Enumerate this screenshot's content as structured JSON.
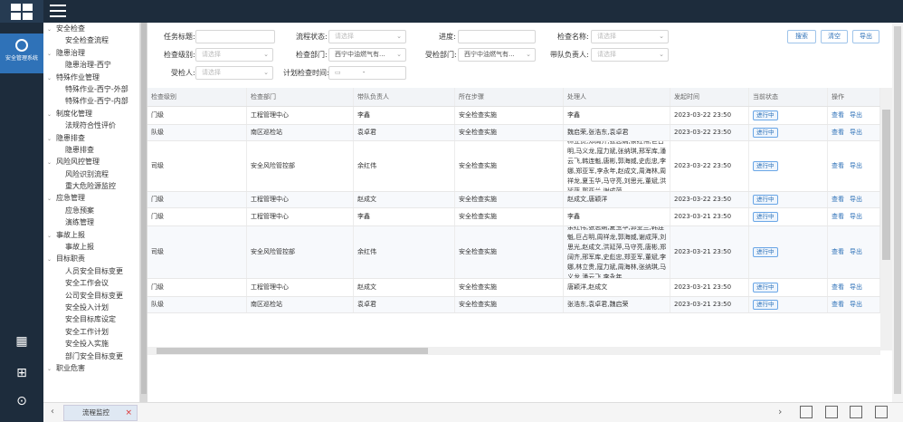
{
  "app": {
    "module_label": "安全管理系统"
  },
  "tree": [
    {
      "label": "安全检查",
      "type": "p"
    },
    {
      "label": "安全检查流程",
      "type": "c"
    },
    {
      "label": "隐患治理",
      "type": "p"
    },
    {
      "label": "隐患治理-西宁",
      "type": "c"
    },
    {
      "label": "特殊作业管理",
      "type": "p"
    },
    {
      "label": "特殊作业-西宁-外部",
      "type": "c"
    },
    {
      "label": "特殊作业-西宁-内部",
      "type": "c"
    },
    {
      "label": "制度化管理",
      "type": "p"
    },
    {
      "label": "法规符合性评价",
      "type": "c"
    },
    {
      "label": "隐患排查",
      "type": "p"
    },
    {
      "label": "隐患排查",
      "type": "c"
    },
    {
      "label": "风险风控管理",
      "type": "p"
    },
    {
      "label": "风险识别流程",
      "type": "c"
    },
    {
      "label": "重大危险源监控",
      "type": "c"
    },
    {
      "label": "应急管理",
      "type": "p"
    },
    {
      "label": "应急预案",
      "type": "c"
    },
    {
      "label": "演练管理",
      "type": "c"
    },
    {
      "label": "事故上报",
      "type": "p"
    },
    {
      "label": "事故上报",
      "type": "c"
    },
    {
      "label": "目标职责",
      "type": "p"
    },
    {
      "label": "人员安全目标变更",
      "type": "c"
    },
    {
      "label": "安全工作会议",
      "type": "c"
    },
    {
      "label": "公司安全目标变更",
      "type": "c"
    },
    {
      "label": "安全投入计划",
      "type": "c"
    },
    {
      "label": "安全目标库设定",
      "type": "c"
    },
    {
      "label": "安全工作计划",
      "type": "c"
    },
    {
      "label": "安全投入实施",
      "type": "c"
    },
    {
      "label": "部门安全目标变更",
      "type": "c"
    },
    {
      "label": "职业危害",
      "type": "p"
    }
  ],
  "filters": {
    "task_title": "任务标题:",
    "process_status": "流程状态:",
    "process_status_ph": "请选择",
    "progress": "进度:",
    "check_name": "检查名称:",
    "check_name_ph": "请选择",
    "check_level": "检查级别:",
    "check_level_ph": "请选择",
    "check_dept": "检查部门:",
    "check_dept_val": "西宁中油燃气有...",
    "checked_dept": "受检部门:",
    "checked_dept_val": "西宁中油燃气有...",
    "team_leader": "带队负责人:",
    "team_leader_ph": "请选择",
    "inspected": "受检人:",
    "inspected_ph": "请选择",
    "plan_time": "计划检查时间:",
    "plan_time_sep": "-"
  },
  "buttons": {
    "search": "搜索",
    "clear": "清空",
    "export": "导出"
  },
  "columns": [
    "检查级别",
    "检查部门",
    "带队负责人",
    "所在步骤",
    "处理人",
    "发起时间",
    "当前状态",
    "操作"
  ],
  "rows": [
    {
      "level": "门级",
      "dept": "工程管理中心",
      "leader": "李鑫",
      "step": "安全检查实施",
      "handler": "李鑫",
      "time": "2023-03-22 23:50",
      "status": "进行中"
    },
    {
      "level": "队级",
      "dept": "南区巡检站",
      "leader": "袁卓君",
      "step": "安全检查实施",
      "handler": "魏启荣,张浩东,袁卓君",
      "time": "2023-03-22 23:50",
      "status": "进行中"
    },
    {
      "level": "司级",
      "dept": "安全风险管控部",
      "leader": "余红伟",
      "step": "安全检查实施",
      "handler": "林立贵,郑阔齐,张志娴,余红伟,巨占明,马义龙,寇力斌,张纳琪,邢军库,潘云飞,韩连魁,唐彬,郭海威,史彪忠,李娜,郑亚军,李永年,赵成文,周海林,周祥龙,夏玉华,马守亮,刘思光,董斌,洪延萍,郭亚兰,谢成萍",
      "time": "2023-03-22 23:50",
      "status": "进行中"
    },
    {
      "level": "门级",
      "dept": "工程管理中心",
      "leader": "赵成文",
      "step": "安全检查实施",
      "handler": "赵成文,唐颖洋",
      "time": "2023-03-22 23:50",
      "status": "进行中"
    },
    {
      "level": "门级",
      "dept": "工程管理中心",
      "leader": "李鑫",
      "step": "安全检查实施",
      "handler": "李鑫",
      "time": "2023-03-21 23:50",
      "status": "进行中"
    },
    {
      "level": "司级",
      "dept": "安全风险管控部",
      "leader": "余红伟",
      "step": "安全检查实施",
      "handler": "余红伟,张志娴,夏玉华,郭亚兰,韩连魁,巨占明,周祥龙,郭海威,谢成萍,刘思光,赵成文,洪延萍,马守亮,唐彬,郑阔齐,邢军库,史彪忠,郑亚军,董斌,李娜,林立贵,寇力斌,周海林,张纳琪,马义龙,潘云飞,李永年",
      "time": "2023-03-21 23:50",
      "status": "进行中"
    },
    {
      "level": "门级",
      "dept": "工程管理中心",
      "leader": "赵成文",
      "step": "安全检查实施",
      "handler": "唐颖洋,赵成文",
      "time": "2023-03-21 23:50",
      "status": "进行中"
    },
    {
      "level": "队级",
      "dept": "南区巡检站",
      "leader": "袁卓君",
      "step": "安全检查实施",
      "handler": "张浩东,袁卓君,魏启荣",
      "time": "2023-03-21 23:50",
      "status": "进行中"
    }
  ],
  "actions": {
    "view": "查看",
    "export": "导出"
  },
  "bottom_tab": {
    "label": "流程监控",
    "close": "×"
  }
}
